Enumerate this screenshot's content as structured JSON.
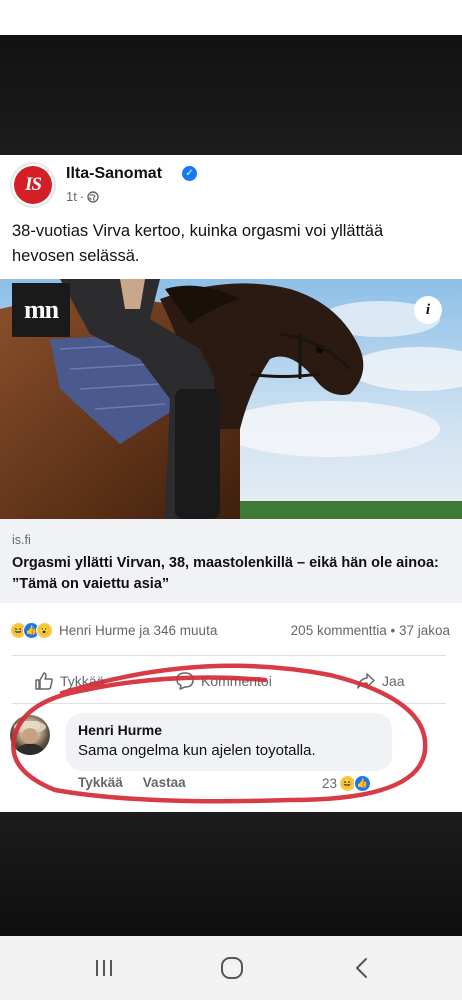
{
  "post": {
    "page_name": "Ilta-Sanomat",
    "logo_text": "IS",
    "time": "1t",
    "text": "38-vuotias Virva kertoo, kuinka orgasmi voi yllättää hevosen selässä.",
    "image_badge": "mn",
    "info_glyph": "i",
    "link_domain": "is.fi",
    "link_title": "Orgasmi yllätti Virvan, 38, maastolenkillä – eikä hän ole ainoa: ”Tämä on vaiettu asia”",
    "reactors": "Henri Hurme ja 346 muuta",
    "counts": "205 kommenttia • 37 jakoa",
    "actions": {
      "like": "Tykkää",
      "comment": "Kommentoi",
      "share": "Jaa"
    }
  },
  "comment": {
    "author": "Henri Hurme",
    "text": "Sama ongelma kun ajelen toyotalla.",
    "like": "Tykkää",
    "reply": "Vastaa",
    "reaction_count": "23"
  },
  "icons": {
    "verified": "verified-badge-icon",
    "globe": "globe-icon",
    "like": "thumbs-up-icon",
    "comment": "speech-bubble-icon",
    "share": "share-arrow-icon",
    "nav_recent": "recent-apps-icon",
    "nav_home": "home-icon",
    "nav_back": "back-icon"
  },
  "colors": {
    "facebook_blue": "#1877f2",
    "is_red": "#d51f26",
    "annotation_red": "#d42a36"
  }
}
